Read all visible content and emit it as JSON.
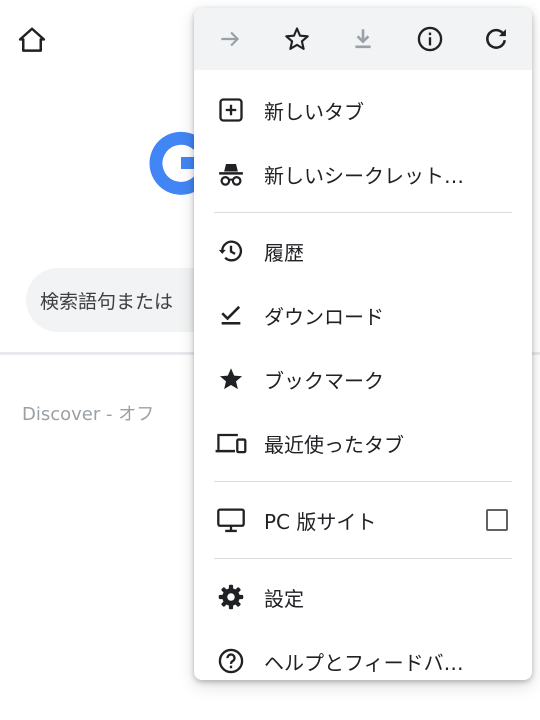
{
  "background": {
    "search_placeholder": "検索語句または",
    "discover_label": "Discover - オフ"
  },
  "menu": {
    "toolbar": [
      {
        "name": "forward-icon"
      },
      {
        "name": "bookmark-star-icon"
      },
      {
        "name": "download-icon"
      },
      {
        "name": "info-icon"
      },
      {
        "name": "reload-icon"
      }
    ],
    "items": [
      {
        "label": "新しいタブ",
        "icon": "plus-box-icon"
      },
      {
        "label": "新しいシークレット…",
        "icon": "incognito-icon"
      },
      {
        "label": "履歴",
        "icon": "history-icon"
      },
      {
        "label": "ダウンロード",
        "icon": "download-check-icon"
      },
      {
        "label": "ブックマーク",
        "icon": "star-filled-icon"
      },
      {
        "label": "最近使ったタブ",
        "icon": "devices-icon"
      },
      {
        "label": "PC 版サイト",
        "icon": "monitor-icon",
        "checked": false
      },
      {
        "label": "設定",
        "icon": "gear-icon"
      },
      {
        "label": "ヘルプとフィードバ…",
        "icon": "help-icon"
      }
    ]
  },
  "colors": {
    "toolbar_bg": "#f1f3f4",
    "icon": "#202124",
    "disabled_icon": "#9aa0a6",
    "google_blue": "#4285f4"
  }
}
